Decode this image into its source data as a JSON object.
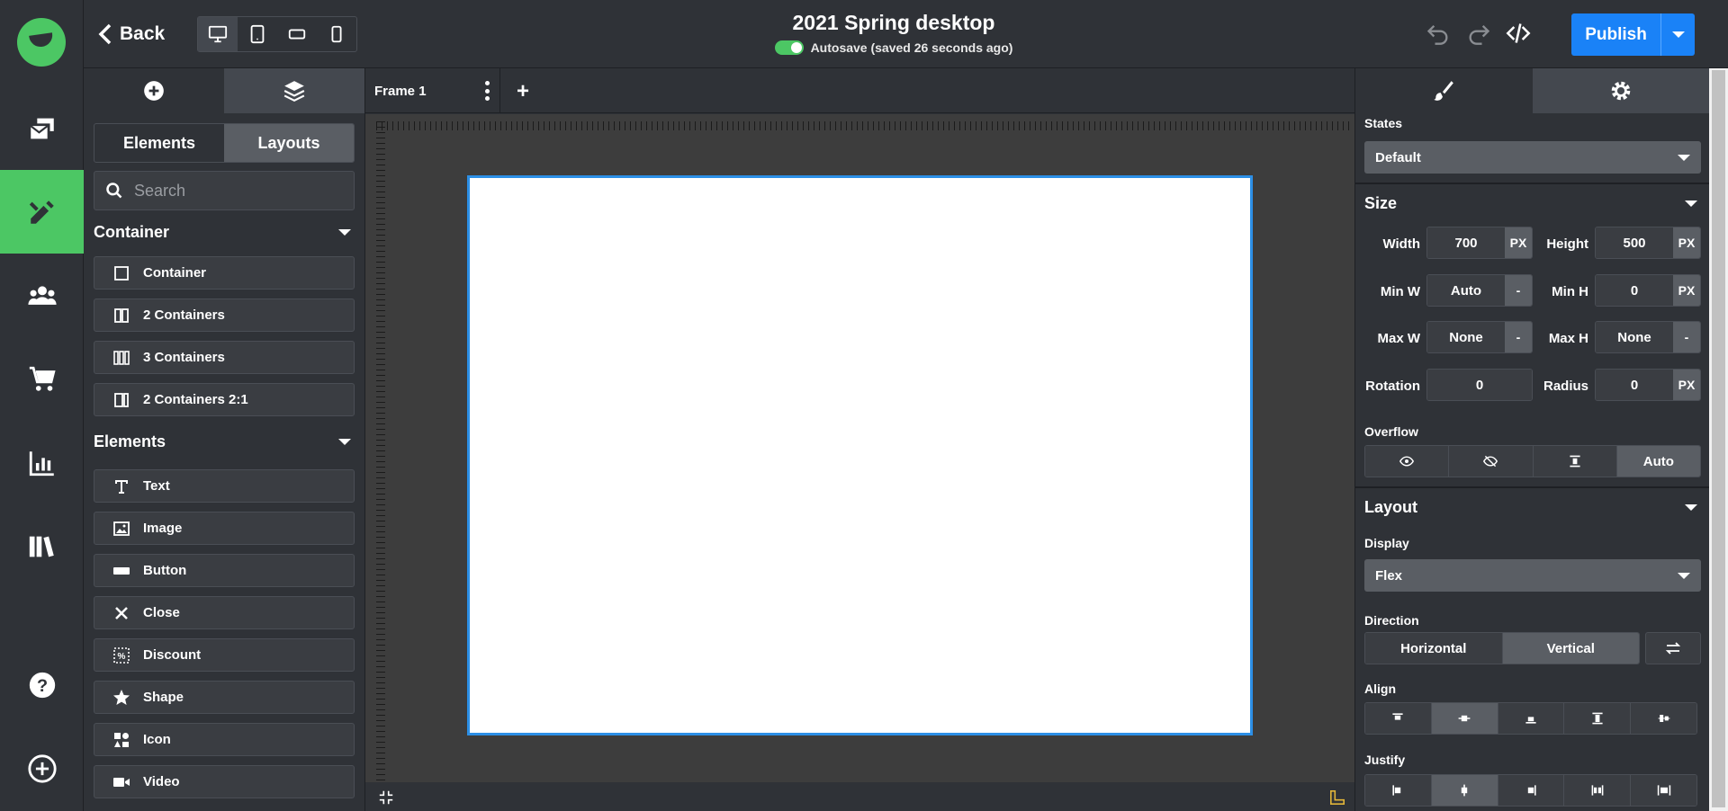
{
  "topbar": {
    "back_label": "Back",
    "title": "2021 Spring desktop",
    "autosave_text": "Autosave (saved 26 seconds ago)",
    "publish_label": "Publish"
  },
  "left_panel": {
    "segment": [
      "Elements",
      "Layouts"
    ],
    "search_placeholder": "Search",
    "container_section": "Container",
    "container_items": [
      "Container",
      "2 Containers",
      "3 Containers",
      "2 Containers 2:1"
    ],
    "elements_section": "Elements",
    "element_items": [
      "Text",
      "Image",
      "Button",
      "Close",
      "Discount",
      "Shape",
      "Icon",
      "Video"
    ]
  },
  "canvas": {
    "frame_tab": "Frame 1",
    "add_label": "+"
  },
  "right_panel": {
    "states_label": "States",
    "states_value": "Default",
    "size_head": "Size",
    "width_label": "Width",
    "width_value": "700",
    "width_unit": "PX",
    "height_label": "Height",
    "height_value": "500",
    "height_unit": "PX",
    "minw_label": "Min W",
    "minw_value": "Auto",
    "minw_unit": "-",
    "minh_label": "Min H",
    "minh_value": "0",
    "minh_unit": "PX",
    "maxw_label": "Max W",
    "maxw_value": "None",
    "maxw_unit": "-",
    "maxh_label": "Max H",
    "maxh_value": "None",
    "maxh_unit": "-",
    "rotation_label": "Rotation",
    "rotation_value": "0",
    "radius_label": "Radius",
    "radius_value": "0",
    "radius_unit": "PX",
    "overflow_label": "Overflow",
    "overflow_auto": "Auto",
    "layout_head": "Layout",
    "display_label": "Display",
    "display_value": "Flex",
    "direction_label": "Direction",
    "direction_options": [
      "Horizontal",
      "Vertical"
    ],
    "align_label": "Align",
    "justify_label": "Justify"
  },
  "colors": {
    "accent_green": "#4cc764",
    "publish_blue": "#1a82f7",
    "selection_blue": "#2c8fe6"
  }
}
